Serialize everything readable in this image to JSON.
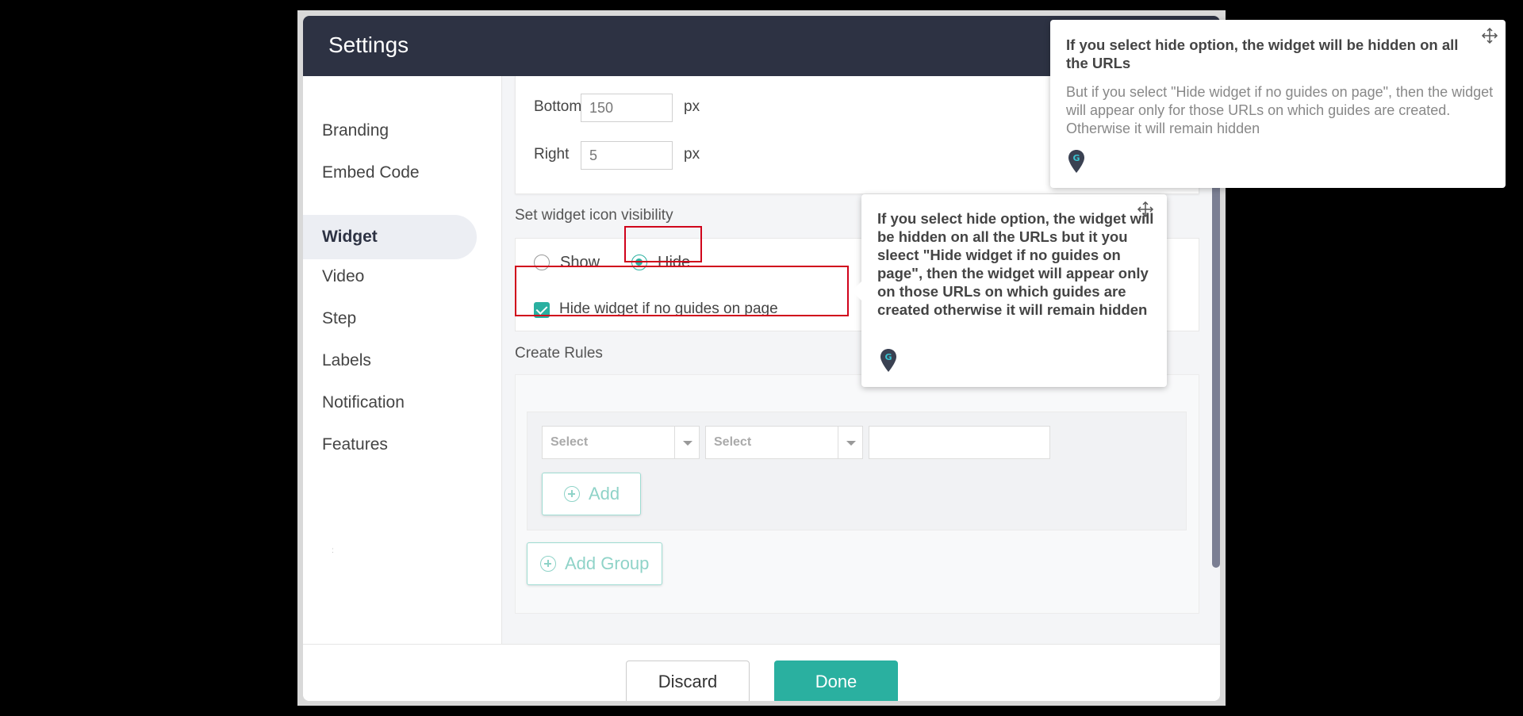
{
  "modal": {
    "title": "Settings"
  },
  "sidebar": {
    "items": [
      {
        "label": "Branding"
      },
      {
        "label": "Embed Code"
      },
      {
        "label": "Widget"
      },
      {
        "label": "Video"
      },
      {
        "label": "Step"
      },
      {
        "label": "Labels"
      },
      {
        "label": "Notification"
      },
      {
        "label": "Features"
      }
    ],
    "active": "Widget",
    "dot": ":"
  },
  "position": {
    "bottom": {
      "label": "Bottom",
      "value": "150",
      "unit": "px"
    },
    "right": {
      "label": "Right",
      "value": "5",
      "unit": "px"
    }
  },
  "visibility": {
    "label": "Set widget icon visibility",
    "options": [
      {
        "label": "Show",
        "selected": false
      },
      {
        "label": "Hide",
        "selected": true
      }
    ],
    "checkbox_label": "Hide widget if no guides on page",
    "checkbox_checked": true
  },
  "rules": {
    "label": "Create Rules",
    "select1_placeholder": "Select",
    "select2_placeholder": "Select",
    "add_label": "Add",
    "add_group_label": "Add Group"
  },
  "footer": {
    "discard_label": "Discard",
    "done_label": "Done"
  },
  "tooltip_top": {
    "title": "If you select hide option, the widget will be hidden on all the URLs",
    "body": "But if you select \"Hide widget if no guides on page\", then the widget will appear only for those URLs on which guides are created. Otherwise it will remain hidden"
  },
  "tooltip_mid": {
    "title": "If you select hide option, the widget will be hidden on all the URLs but it you sleect \"Hide widget if no guides on page\", then the widget will appear only on those URLs on which guides are created otherwise it will remain hidden"
  },
  "colors": {
    "accent": "#2ab0a0",
    "header": "#2d3243",
    "highlight": "#d0021b"
  }
}
